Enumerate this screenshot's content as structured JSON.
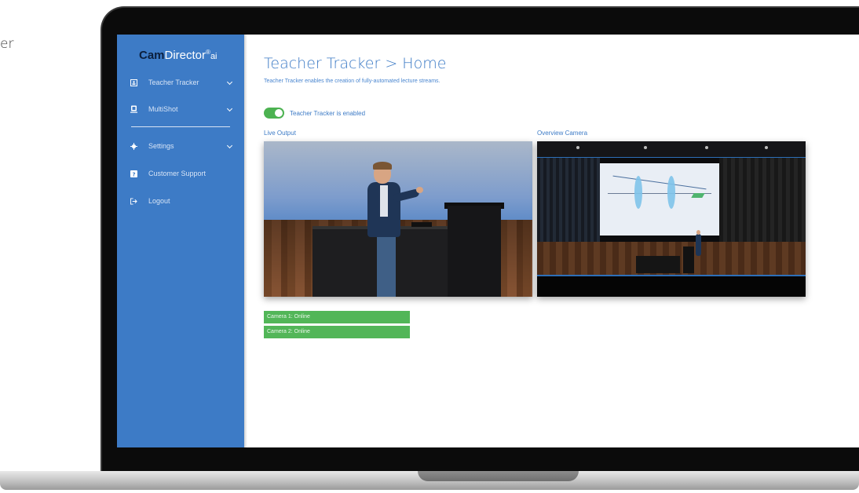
{
  "background_text": "er",
  "app": {
    "logo_bold": "Cam",
    "logo_rest": "Director",
    "logo_mark": "®",
    "logo_suffix": "ai"
  },
  "sidebar": {
    "items": [
      {
        "label": "Teacher Tracker",
        "icon": "person-icon",
        "expandable": true
      },
      {
        "label": "MultiShot",
        "icon": "camera-icon",
        "expandable": true
      },
      {
        "label": "Settings",
        "icon": "gear-icon",
        "expandable": true
      },
      {
        "label": "Customer Support",
        "icon": "question-icon",
        "expandable": false
      },
      {
        "label": "Logout",
        "icon": "logout-icon",
        "expandable": false
      }
    ]
  },
  "main": {
    "title": "Teacher Tracker > Home",
    "subtitle": "Teacher Tracker enables the creation of fully-automated lecture streams.",
    "toggle": {
      "label": "Teacher Tracker is enabled",
      "enabled": true
    },
    "live_label": "Live Output",
    "overview_label": "Overview Camera",
    "statuses": [
      {
        "label": "Camera 1: Online"
      },
      {
        "label": "Camera 2: Online"
      }
    ]
  },
  "colors": {
    "accent": "#3d7bc6",
    "online": "#52b658",
    "toggle_on": "#4cb251"
  }
}
